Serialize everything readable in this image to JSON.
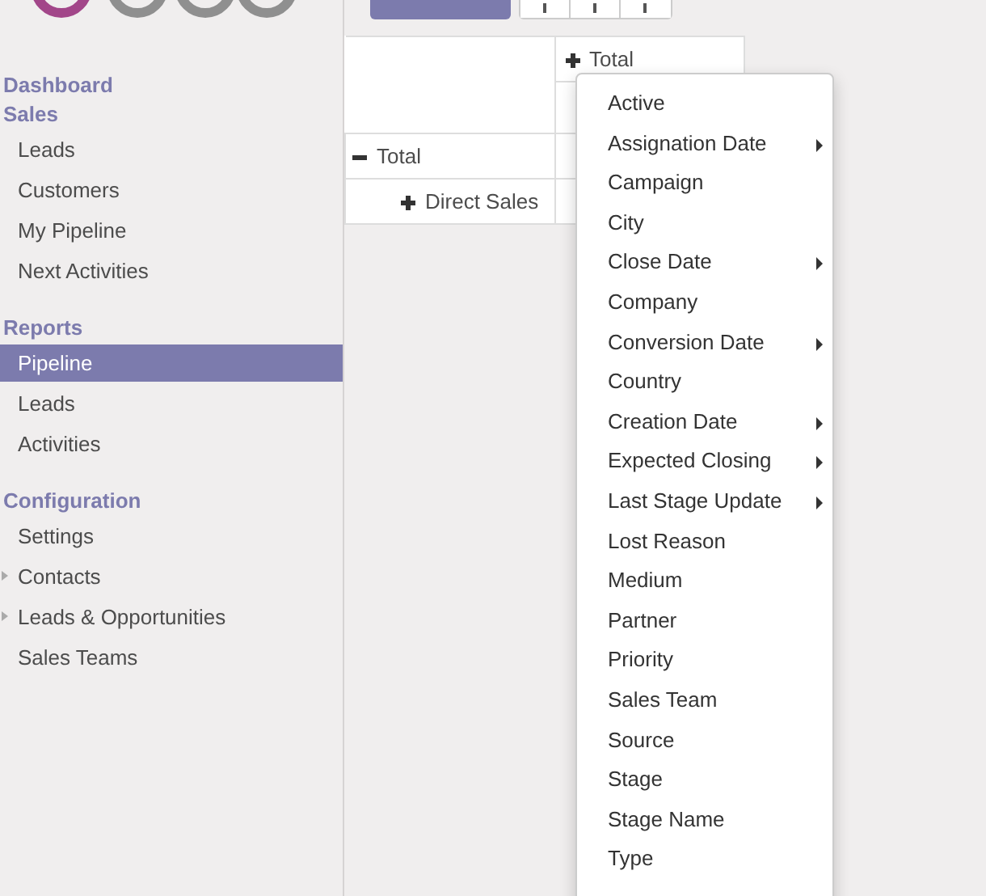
{
  "toolbar": {
    "buttons": [
      {
        "kind": "primary"
      },
      {
        "kind": "icon"
      },
      {
        "kind": "icon"
      },
      {
        "kind": "icon"
      }
    ]
  },
  "sidebar": {
    "items": [
      {
        "kind": "header",
        "label": "Dashboard",
        "selected": false
      },
      {
        "kind": "header",
        "label": "Sales",
        "selected": false
      },
      {
        "kind": "link",
        "label": "Leads",
        "selected": false
      },
      {
        "kind": "link",
        "label": "Customers",
        "selected": false
      },
      {
        "kind": "link",
        "label": "My Pipeline",
        "selected": false
      },
      {
        "kind": "link",
        "label": "Next Activities",
        "selected": false
      },
      {
        "kind": "header",
        "label": "Reports",
        "selected": false
      },
      {
        "kind": "link",
        "label": "Pipeline",
        "selected": true
      },
      {
        "kind": "link",
        "label": "Leads",
        "selected": false
      },
      {
        "kind": "link",
        "label": "Activities",
        "selected": false
      },
      {
        "kind": "header",
        "label": "Configuration",
        "selected": false
      },
      {
        "kind": "link",
        "label": "Settings",
        "selected": false
      },
      {
        "kind": "folder",
        "label": "Contacts",
        "selected": false
      },
      {
        "kind": "folder",
        "label": "Leads & Opportunities",
        "selected": false
      },
      {
        "kind": "link",
        "label": "Sales Teams",
        "selected": false
      }
    ]
  },
  "pivot": {
    "column_header": {
      "label": "Total",
      "expanded": false
    },
    "rows": [
      {
        "label": "Total",
        "expanded": true,
        "children": [
          {
            "label": "Direct Sales",
            "expanded": false
          }
        ]
      }
    ]
  },
  "group_menu": {
    "items": [
      {
        "label": "Active",
        "submenu": false
      },
      {
        "label": "Assignation Date",
        "submenu": true
      },
      {
        "label": "Campaign",
        "submenu": false
      },
      {
        "label": "City",
        "submenu": false
      },
      {
        "label": "Close Date",
        "submenu": true
      },
      {
        "label": "Company",
        "submenu": false
      },
      {
        "label": "Conversion Date",
        "submenu": true
      },
      {
        "label": "Country",
        "submenu": false
      },
      {
        "label": "Creation Date",
        "submenu": true
      },
      {
        "label": "Expected Closing",
        "submenu": true
      },
      {
        "label": "Last Stage Update",
        "submenu": true
      },
      {
        "label": "Lost Reason",
        "submenu": false
      },
      {
        "label": "Medium",
        "submenu": false
      },
      {
        "label": "Partner",
        "submenu": false
      },
      {
        "label": "Priority",
        "submenu": false
      },
      {
        "label": "Sales Team",
        "submenu": false
      },
      {
        "label": "Source",
        "submenu": false
      },
      {
        "label": "Stage",
        "submenu": false
      },
      {
        "label": "Stage Name",
        "submenu": false
      },
      {
        "label": "Type",
        "submenu": false
      }
    ]
  }
}
